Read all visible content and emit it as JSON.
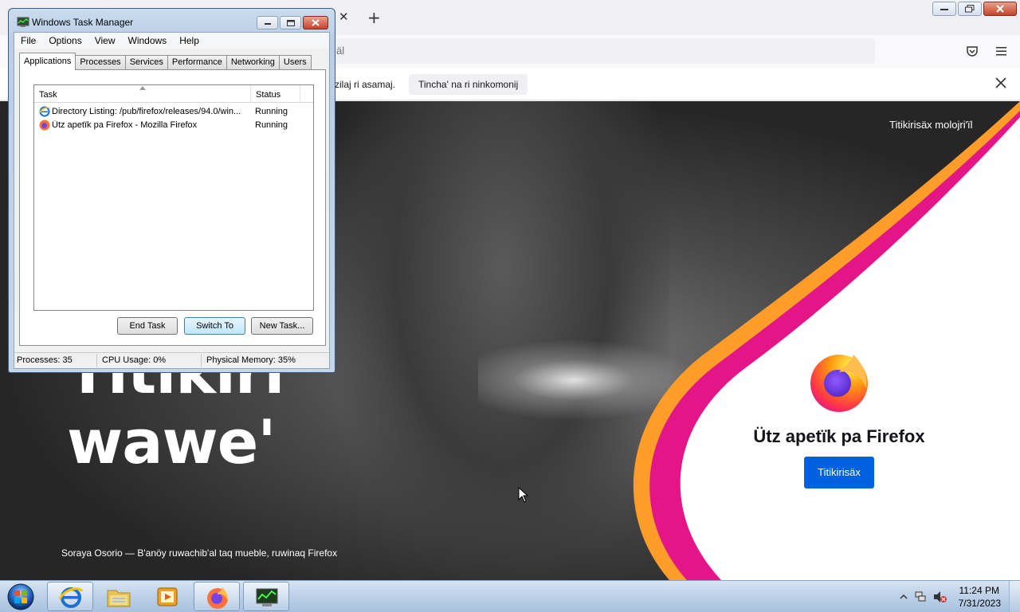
{
  "firefox": {
    "url_partial": "äl",
    "notification": {
      "text": "zilaj ri asamaj.",
      "button_label": "Tincha' na ri ninkomonij"
    },
    "hero": {
      "line1": "Titikiri",
      "line2": "wawe'"
    },
    "photo_credit": "Soraya Osorio — B'anöy ruwachib'al taq mueble, ruwinaq Firefox",
    "promo": {
      "top_link": "Titikirisäx molojri'ïl",
      "heading": "Ütz apetïk pa Firefox",
      "button_label": "Titikirisäx"
    },
    "colors": {
      "promo_button": "#0061e0",
      "pink_curve": "#e31587",
      "orange_curve": "#ff9d2a"
    }
  },
  "task_manager": {
    "title": "Windows Task Manager",
    "menu": [
      "File",
      "Options",
      "View",
      "Windows",
      "Help"
    ],
    "tabs": [
      "Applications",
      "Processes",
      "Services",
      "Performance",
      "Networking",
      "Users"
    ],
    "active_tab": "Applications",
    "columns": {
      "task": "Task",
      "status": "Status"
    },
    "rows": [
      {
        "task": "Directory Listing: /pub/firefox/releases/94.0/win...",
        "status": "Running",
        "icon": "ie-icon"
      },
      {
        "task": "Ütz apetïk pa Firefox - Mozilla Firefox",
        "status": "Running",
        "icon": "firefox-icon"
      }
    ],
    "buttons": {
      "end_task": "End Task",
      "switch_to": "Switch To",
      "new_task": "New Task..."
    },
    "status_bar": {
      "processes": "Processes: 35",
      "cpu": "CPU Usage: 0%",
      "memory": "Physical Memory: 35%"
    }
  },
  "taskbar": {
    "apps": [
      "internet-explorer-icon",
      "windows-explorer-icon",
      "media-player-icon",
      "firefox-icon",
      "task-manager-icon"
    ],
    "clock": {
      "time": "11:24 PM",
      "date": "7/31/2023"
    }
  }
}
